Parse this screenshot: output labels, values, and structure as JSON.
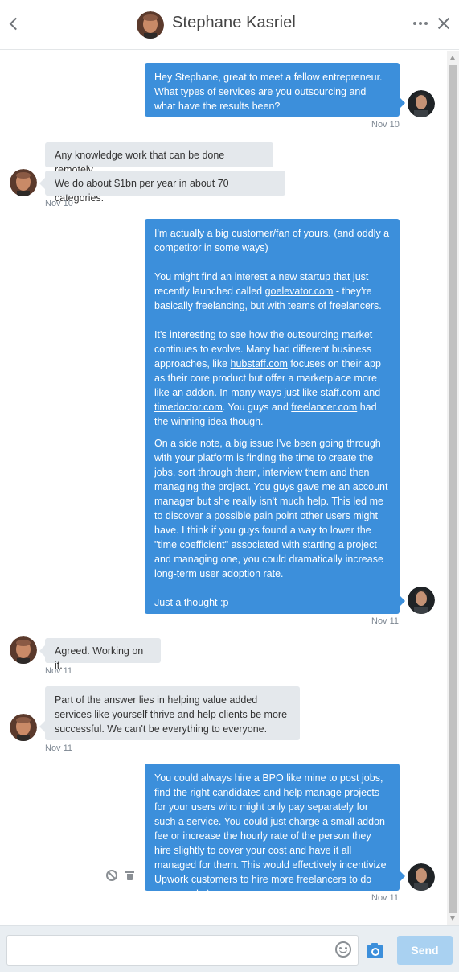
{
  "header": {
    "title": "Stephane Kasriel",
    "avatar_color": "#8a5a44"
  },
  "colors": {
    "outgoing_bubble": "#3c8fdb",
    "incoming_bubble": "#e4e8ec",
    "send_button": "#a9d1f1"
  },
  "icons": {
    "back": "chevron-left-icon",
    "more": "ellipsis-icon",
    "close": "close-icon",
    "ban": "ban-icon",
    "trash": "trash-icon",
    "emoji": "smiley-icon",
    "camera": "camera-icon"
  },
  "messages": [
    {
      "from": "me",
      "paragraphs": [
        "Hey Stephane, great to meet a fellow entrepreneur. What types of services are you outsourcing and what have the results been?"
      ],
      "timestamp": "Nov 10"
    },
    {
      "from": "them",
      "paragraphs": [
        "Any knowledge work that can be done remotely."
      ]
    },
    {
      "from": "them",
      "paragraphs": [
        "We do about $1bn per year in about 70 categories."
      ],
      "timestamp": "Nov 10"
    },
    {
      "from": "me",
      "p1": "I'm actually a big customer/fan of yours. (and oddly a competitor in some ways)",
      "p2_a": "You might find an interest a new startup that just recently launched called ",
      "p2_link": "goelevator.com",
      "p2_b": " - they're basically freelancing, but with teams of freelancers.",
      "p3_a": "It's interesting to see how the outsourcing market continues to evolve. Many had different business approaches, like ",
      "p3_link1": "hubstaff.com",
      "p3_b": " focuses on their app as their core product but offer a marketplace more like an addon. In many ways just like ",
      "p3_link2": "staff.com",
      "p3_c": " and ",
      "p3_link3": "timedoctor.com",
      "p3_d": ". You guys and ",
      "p3_link4": "freelancer.com",
      "p3_e": " had the winning idea though.",
      "p4": "On a side note, a big issue I've been going through with your platform is finding the time to create the jobs, sort through them, interview them and then managing the project. You guys gave me an account manager but she really isn't much help. This led me to discover a possible pain point other users might have. I think if you guys found a way to lower the \"time coefficient\" associated with starting a project and managing one, you could dramatically increase long-term user adoption rate.",
      "p5": "Just a thought :p",
      "timestamp": "Nov 11"
    },
    {
      "from": "them",
      "paragraphs": [
        "Agreed. Working on it."
      ],
      "timestamp": "Nov 11"
    },
    {
      "from": "them",
      "paragraphs": [
        "Part of the answer lies in helping value added services like yourself thrive and help clients be more successful. We can't be everything to everyone."
      ],
      "timestamp": "Nov 11"
    },
    {
      "from": "me",
      "paragraphs": [
        "You could always hire a BPO like mine to post jobs, find the right candidates and help manage projects for your users who might only pay separately for such a service. You could just charge a small addon fee or increase the hourly rate of the person they hire slightly to cover your cost and have it all managed for them. This would effectively incentivize Upwork customers to hire more freelancers to do more work :)"
      ],
      "timestamp": "Nov 11"
    }
  ],
  "composer": {
    "value": "",
    "placeholder": "",
    "send_label": "Send"
  }
}
